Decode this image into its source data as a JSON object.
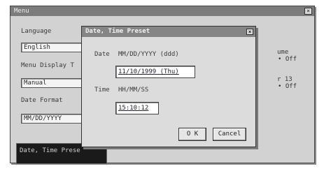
{
  "main_window": {
    "title": "Menu",
    "language_label": "Language",
    "language_value": "English",
    "menu_display_label": "Menu Display T",
    "menu_display_value": "Manual",
    "date_format_label": "Date Format",
    "date_format_value": "MM/DD/YYYY",
    "right_partial_1": "ume",
    "right_radio_1": "Off",
    "right_partial_2": "r 13",
    "right_radio_2": "Off",
    "date_time_button": "Date, Time Prese"
  },
  "dialog": {
    "title": "Date, Time Preset",
    "date_label": "Date",
    "date_format_hint": "MM/DD/YYYY (ddd)",
    "date_value": "11/10/1999 (Thu)",
    "time_label": "Time",
    "time_format_hint": "HH/MM/SS",
    "time_value": "15:10:12",
    "ok_label": "O K",
    "cancel_label": "Cancel"
  }
}
